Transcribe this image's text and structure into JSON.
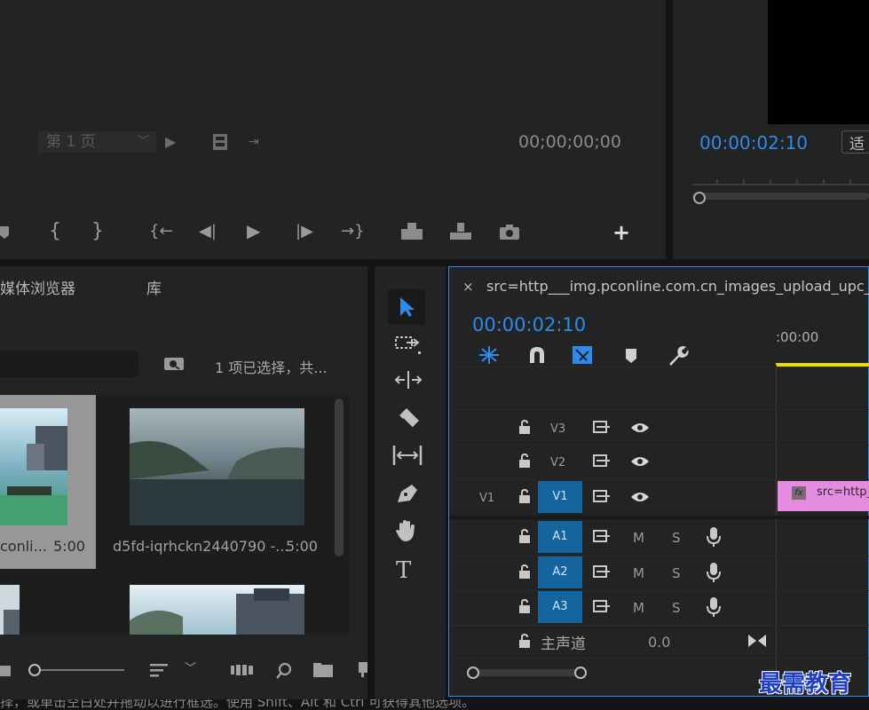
{
  "source_monitor": {
    "page_label": "第 1 页",
    "timecode": "00;00;00;00"
  },
  "program_monitor": {
    "timecode": "00:00:02:10",
    "fit_label": "适"
  },
  "media_browser": {
    "tab_media_browser": "媒体浏览器",
    "tab_library": "库",
    "selection_status": "1 项已选择，共...",
    "clips": [
      {
        "name": "conli...",
        "duration": "5:00"
      },
      {
        "name": "d5fd-iqrhckn2440790 -...",
        "duration": "5:00"
      }
    ]
  },
  "timeline": {
    "sequence_name": "src=http___img.pconline.com.cn_images_upload_upc_t",
    "timecode": "00:00:02:10",
    "ruler_start": ":00:00",
    "tracks": {
      "video": [
        {
          "name": "V3",
          "source": ""
        },
        {
          "name": "V2",
          "source": ""
        },
        {
          "name": "V1",
          "source": "V1"
        }
      ],
      "audio": [
        {
          "name": "A1",
          "m": "M",
          "s": "S"
        },
        {
          "name": "A2",
          "m": "M",
          "s": "S"
        },
        {
          "name": "A3",
          "m": "M",
          "s": "S"
        }
      ],
      "master": {
        "label": "主声道",
        "value": "0.0"
      }
    },
    "clip_label": "src=http_",
    "fx_label": "fx"
  },
  "status_bar": {
    "text": "择，或单击空白处并拖动以进行框选。使用 Shift、Alt 和 Ctrl 可获得其他选项。"
  },
  "watermark": "最需教育",
  "colors": {
    "accent_blue": "#2d8ceb",
    "playhead_yellow": "#e8e000",
    "clip_pink": "#e58ce0",
    "track_selected": "#1464a0"
  }
}
